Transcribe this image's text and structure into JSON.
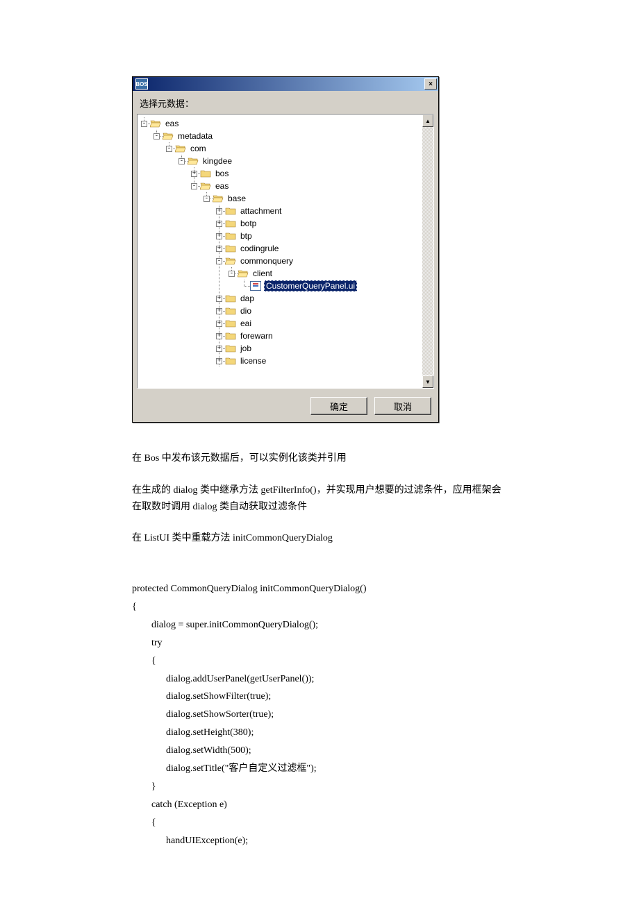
{
  "dialog": {
    "title_icon_text": "BOS",
    "close_glyph": "×",
    "prompt": "选择元数据：",
    "ok": "确定",
    "cancel": "取消",
    "scroll_up": "▲",
    "scroll_down": "▼"
  },
  "tree": {
    "eas": "eas",
    "metadata": "metadata",
    "com": "com",
    "kingdee": "kingdee",
    "bos": "bos",
    "eas2": "eas",
    "base": "base",
    "attachment": "attachment",
    "botp": "botp",
    "btp": "btp",
    "codingrule": "codingrule",
    "commonquery": "commonquery",
    "client": "client",
    "selected_file": "CustomerQueryPanel.ui",
    "dap": "dap",
    "dio": "dio",
    "eai": "eai",
    "forewarn": "forewarn",
    "job": "job",
    "license": "license",
    "plus": "+",
    "minus": "-"
  },
  "text": {
    "p1": "在 Bos 中发布该元数据后，可以实例化该类并引用",
    "p2": "在生成的 dialog 类中继承方法 getFilterInfo()，并实现用户想要的过滤条件，应用框架会在取数时调用 dialog 类自动获取过滤条件",
    "p3": "在 ListUI 类中重载方法 initCommonQueryDialog"
  },
  "code": {
    "l1": "protected CommonQueryDialog initCommonQueryDialog()",
    "l2": "{",
    "l3": "        dialog = super.initCommonQueryDialog();",
    "l4": "        try",
    "l5": "        {",
    "l6": "              dialog.addUserPanel(getUserPanel());",
    "l7": "              dialog.setShowFilter(true);",
    "l8": "              dialog.setShowSorter(true);",
    "l9": "              dialog.setHeight(380);",
    "l10": "              dialog.setWidth(500);",
    "l11": "              dialog.setTitle(\"客户自定义过滤框\");",
    "l12": "        }",
    "l13": "        catch (Exception e)",
    "l14": "        {",
    "l15": "              handUIException(e);"
  }
}
